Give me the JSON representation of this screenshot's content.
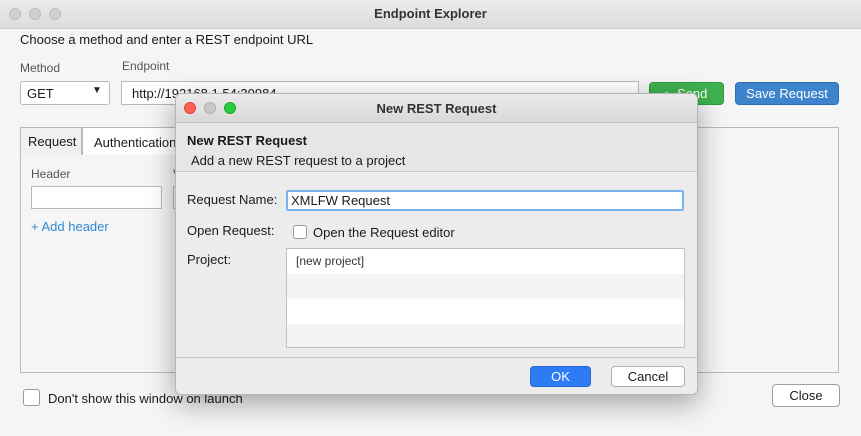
{
  "main_window": {
    "title": "Endpoint Explorer",
    "instruction": "Choose a method and enter a REST endpoint URL",
    "method_label": "Method",
    "method_value": "GET",
    "endpoint_label": "Endpoint",
    "endpoint_value": "http://192168.1.54:30984",
    "send_label": "Send",
    "save_request_label": "Save Request",
    "tabs": [
      {
        "label": "Request"
      },
      {
        "label": "Authentication"
      }
    ],
    "header_label": "Header",
    "value_label_fragment": "V",
    "add_header_label": "+ Add header",
    "dont_show_label": "Don't show this window on launch",
    "close_label": "Close"
  },
  "dialog": {
    "title": "New REST Request",
    "header_title": "New REST Request",
    "header_subtitle": "Add a new REST request to a project",
    "request_name_label": "Request Name:",
    "request_name_value": "XMLFW Request",
    "open_request_label": "Open Request:",
    "open_editor_label": "Open the Request editor",
    "project_label": "Project:",
    "projects": [
      "[new project]"
    ],
    "ok_label": "OK",
    "cancel_label": "Cancel"
  },
  "colors": {
    "send_green": "#3fb24f",
    "save_blue": "#3d84cc",
    "ok_blue": "#2d7cf6",
    "link_blue": "#2e8bd6",
    "close_red": "#fe5f57",
    "minimize_gray": "#c8c8c8",
    "zoom_green": "#29c940"
  }
}
